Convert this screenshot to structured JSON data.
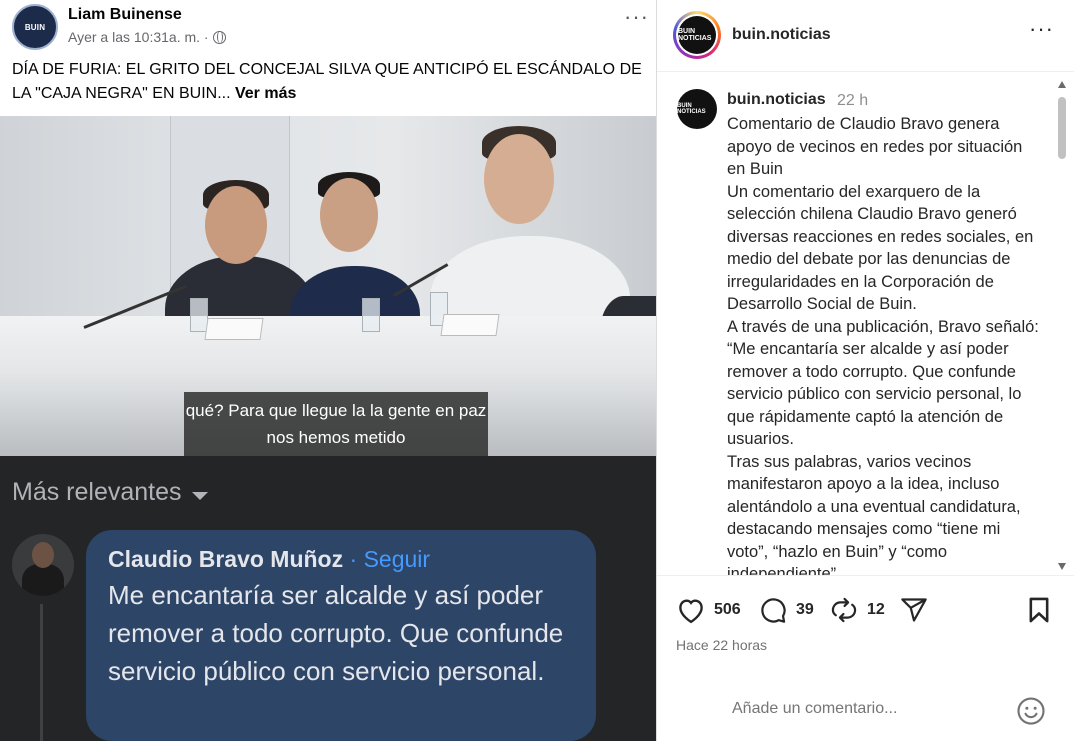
{
  "facebook": {
    "avatar_text": "BUIN",
    "author": "Liam Buinense",
    "timestamp": "Ayer a las 10:31a. m. ·",
    "caption": "DÍA DE FURIA: EL GRITO DEL CONCEJAL SILVA QUE ANTICIPÓ EL ESCÁNDALO DE LA \"CAJA NEGRA\" EN BUIN...",
    "see_more": "Ver más",
    "video_subtitle": "qué? Para que llegue la la gente en paz nos hemos metido",
    "comments_filter": "Más relevantes",
    "comment": {
      "author": "Claudio Bravo Muñoz",
      "separator": " · ",
      "follow": "Seguir",
      "text": "Me encantaría ser alcalde y así poder remover a todo corrupto. Que confunde servicio público con servicio personal."
    }
  },
  "instagram": {
    "username": "buin.noticias",
    "logo_text": "BUIN NOTICIAS",
    "caption_user": "buin.noticias",
    "caption_time": "22 h",
    "caption_text": "Comentario de Claudio Bravo genera apoyo de vecinos en redes por situación en Buin\nUn comentario del exarquero de la selección chilena Claudio Bravo generó diversas reacciones en redes sociales, en medio del debate por las denuncias de irregularidades en la Corporación de Desarrollo Social de Buin.\nA través de una publicación, Bravo señaló: “Me encantaría ser alcalde y así poder remover a todo corrupto. Que confunde servicio público con servicio personal, lo que rápidamente captó la atención de usuarios.\nTras sus palabras, varios vecinos manifestaron apoyo a la idea, incluso alentándolo a una eventual candidatura, destacando mensajes como “tiene mi voto”, “hazlo en Buin” y “como independiente”",
    "likes": "506",
    "comments": "39",
    "reposts": "12",
    "posted_ago": "Hace 22 horas",
    "comment_placeholder": "Añade un comentario...",
    "icons": [
      "heart-icon",
      "comment-icon",
      "repost-icon",
      "share-icon",
      "bookmark-icon",
      "emoji-icon",
      "more-icon",
      "globe-icon"
    ]
  }
}
